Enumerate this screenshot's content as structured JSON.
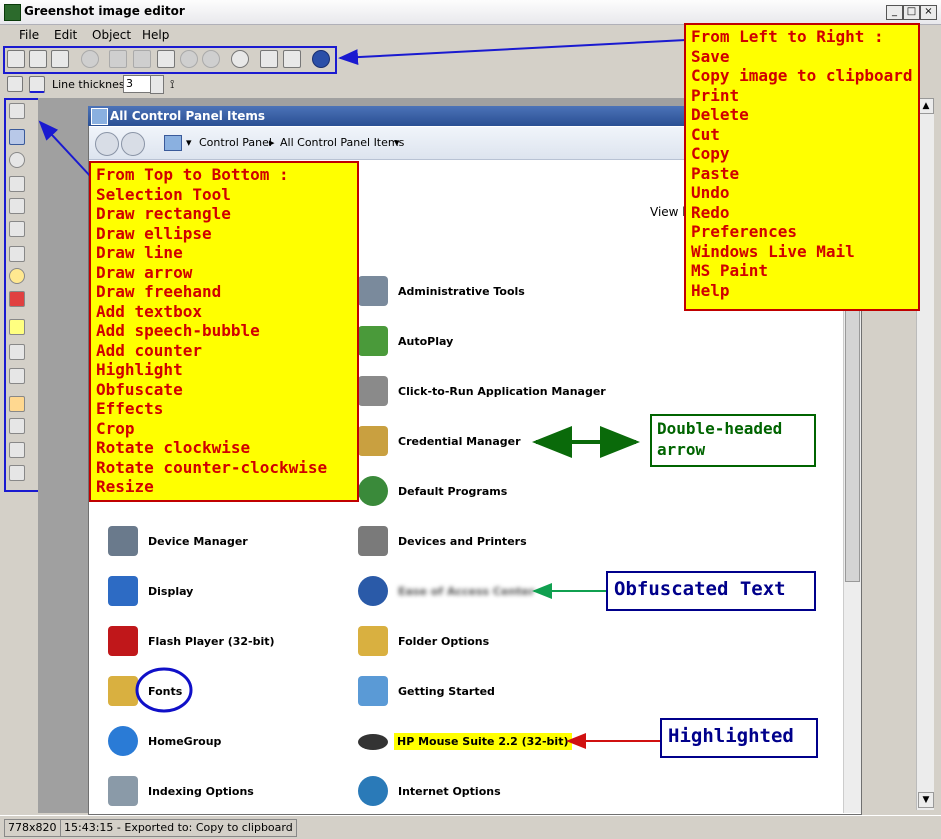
{
  "window": {
    "title": "Greenshot image editor"
  },
  "menu": [
    "File",
    "Edit",
    "Object",
    "Help"
  ],
  "toolbar": {
    "line_thickness_label": "Line thickness",
    "line_thickness_value": "3"
  },
  "inner_window": {
    "title": "All Control Panel Items",
    "breadcrumb": [
      "Control Panel",
      "All Control Panel Items"
    ],
    "view_by": "View b"
  },
  "items_col1": [
    {
      "label": "Device Manager",
      "icon": "device-manager-icon",
      "color": "#6a7a8c"
    },
    {
      "label": "Display",
      "icon": "display-icon",
      "color": "#2d6bc4"
    },
    {
      "label": "Flash Player (32-bit)",
      "icon": "flash-icon",
      "color": "#c0171a"
    },
    {
      "label": "Fonts",
      "icon": "fonts-icon",
      "color": "#d9b040"
    },
    {
      "label": "HomeGroup",
      "icon": "homegroup-icon",
      "color": "#2a7bd6"
    },
    {
      "label": "Indexing Options",
      "icon": "indexing-icon",
      "color": "#8a9aa8"
    }
  ],
  "items_col2": [
    {
      "label": "Administrative Tools",
      "icon": "admin-tools-icon",
      "color": "#7a8a9c"
    },
    {
      "label": "AutoPlay",
      "icon": "autoplay-icon",
      "color": "#4a9a3a"
    },
    {
      "label": "Click-to-Run Application Manager",
      "icon": "click-to-run-icon",
      "color": "#8a8a8a"
    },
    {
      "label": "Credential Manager",
      "icon": "credential-manager-icon",
      "color": "#c9a040"
    },
    {
      "label": "Default Programs",
      "icon": "default-programs-icon",
      "color": "#3a8a3a"
    },
    {
      "label": "Devices and Printers",
      "icon": "printer-icon",
      "color": "#7a7a7a"
    },
    {
      "label": "Ease of Access Center",
      "icon": "ease-of-access-icon",
      "color": "#2a5aa8"
    },
    {
      "label": "Folder Options",
      "icon": "folder-icon",
      "color": "#d9b040"
    },
    {
      "label": "Getting Started",
      "icon": "getting-started-icon",
      "color": "#5a9ad6"
    },
    {
      "label": "HP Mouse Suite 2.2 (32-bit)",
      "icon": "mouse-icon",
      "color": "#333333"
    },
    {
      "label": "Internet Options",
      "icon": "internet-options-icon",
      "color": "#2a7ab8"
    }
  ],
  "annotations": {
    "left_to_right": [
      "From Left to Right :",
      "Save",
      "Copy image to clipboard",
      "Print",
      "Delete",
      "Cut",
      "Copy",
      "Paste",
      "Undo",
      "Redo",
      "Preferences",
      "Windows Live Mail",
      "MS Paint",
      "Help"
    ],
    "top_to_bottom": [
      "From Top to Bottom :",
      "Selection Tool",
      "Draw rectangle",
      "Draw ellipse",
      "Draw line",
      "Draw arrow",
      "Draw freehand",
      "Add textbox",
      "Add speech-bubble",
      "Add counter",
      "Highlight",
      "Obfuscate",
      "Effects",
      "Crop",
      "Rotate clockwise",
      "Rotate counter-clockwise",
      "Resize"
    ],
    "double_arrow": [
      "Double-headed",
      "arrow"
    ],
    "obfuscated": "Obfuscated Text",
    "highlighted": "Highlighted"
  },
  "status": {
    "size": "778x820",
    "message": "15:43:15 - Exported to: Copy to clipboard"
  },
  "colors": {
    "annotation_yellow": "#ffff00",
    "annotation_red": "#c00000",
    "annotation_green": "#006400",
    "annotation_blue": "#00008b",
    "highlight_box": "#1a1ad0"
  }
}
